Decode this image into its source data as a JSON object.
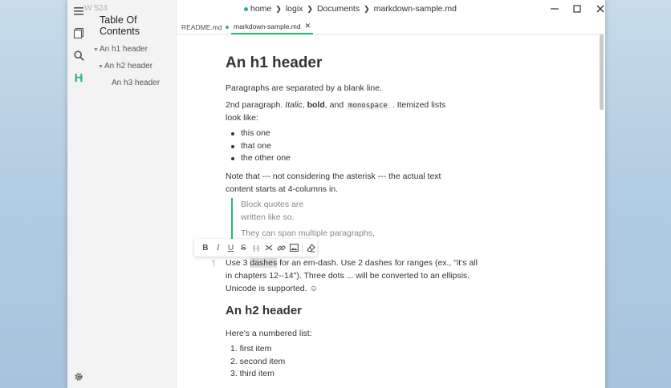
{
  "sidebar": {
    "word_count": "W 524",
    "title": "Table Of Contents",
    "toc": [
      {
        "label": "An h1 header",
        "level": 1
      },
      {
        "label": "An h2 header",
        "level": 2
      },
      {
        "label": "An h3 header",
        "level": 3
      }
    ],
    "rail_icons": [
      "files-icon",
      "search-icon",
      "outline-icon",
      "settings-icon"
    ],
    "outline_glyph": "H"
  },
  "titlebar": {
    "breadcrumb": [
      "home",
      "logix",
      "Documents",
      "markdown-sample.md"
    ],
    "controls": [
      "minimize-icon",
      "maximize-icon",
      "close-icon"
    ]
  },
  "tabs": [
    {
      "label": "README.md",
      "unsaved": true,
      "active": false
    },
    {
      "label": "markdown-sample.md",
      "unsaved": false,
      "active": true
    }
  ],
  "doc": {
    "h1": "An h1 header",
    "p1": "Paragraphs are separated by a blank line.",
    "p2_pre": "2nd paragraph. ",
    "p2_italic": "Italic",
    "p2_mid1": ", ",
    "p2_bold": "bold",
    "p2_mid2": ", and ",
    "p2_code": "monospace",
    "p2_post": " . Itemized lists",
    "p2_line2": "look like:",
    "bullets": [
      "this one",
      "that one",
      "the other one"
    ],
    "note_line1": "Note that --- not considering the asterisk --- the actual text",
    "note_line2": "content starts at 4-columns in.",
    "quote_line1": "Block quotes are",
    "quote_line2": "written like so.",
    "quote_line3": "They can span multiple paragraphs,",
    "dash_pre": "Use 3 ",
    "dash_highlight": "dashes",
    "dash_post": " for an em-dash. Use 2 dashes for ranges (ex., \"it's all",
    "dash_line2": "in chapters 12--14\"). Three dots ... will be converted to an ellipsis.",
    "dash_line3": "Unicode is supported. ☺",
    "h2": "An h2 header",
    "numbered_intro": "Here's a numbered list:",
    "numbered": [
      "1. first item",
      "2. second item",
      "3. third item"
    ]
  },
  "format_toolbar": {
    "bold": "B",
    "italic": "I",
    "underline": "U",
    "strike": "S",
    "code": "{-}",
    "buttons": [
      "bold",
      "italic",
      "underline",
      "strikethrough",
      "inline-code",
      "clear-format",
      "link",
      "image",
      "eraser"
    ]
  }
}
